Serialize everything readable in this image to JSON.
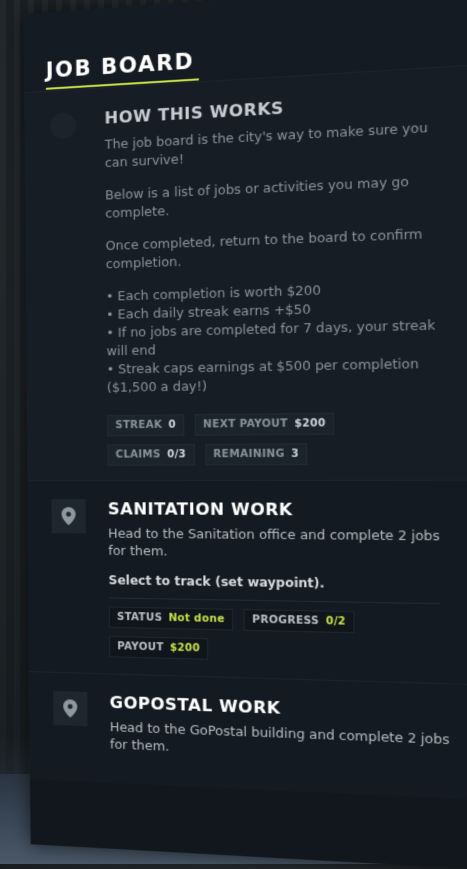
{
  "header": {
    "title": "JOB BOARD"
  },
  "info": {
    "title": "HOW THIS WORKS",
    "paragraphs": [
      "The job board is the city's way to make sure you can survive!",
      "Below is a list of jobs or activities you may go complete.",
      "Once completed, return to the board to confirm completion."
    ],
    "bullets": [
      "• Each completion is worth $200",
      "• Each daily streak earns +$50",
      "• If no jobs are completed for 7 days, your streak will end",
      "• Streak caps earnings at $500 per completion ($1,500 a day!)"
    ],
    "stats": {
      "streak_label": "STREAK",
      "streak_value": "0",
      "next_payout_label": "NEXT PAYOUT",
      "next_payout_value": "$200",
      "claims_label": "CLAIMS",
      "claims_value": "0/3",
      "remaining_label": "REMAINING",
      "remaining_value": "3"
    }
  },
  "jobs": [
    {
      "title": "SANITATION WORK",
      "description": "Head to the Sanitation office and complete 2 jobs for them.",
      "track_text": "Select to track (set waypoint).",
      "status_label": "STATUS",
      "status_value": "Not done",
      "progress_label": "PROGRESS",
      "progress_value": "0/2",
      "payout_label": "PAYOUT",
      "payout_value": "$200",
      "icon": "map-pin-icon"
    },
    {
      "title": "GOPOSTAL WORK",
      "description": "Head to the GoPostal building and complete 2 jobs for them.",
      "icon": "map-pin-icon"
    }
  ],
  "colors": {
    "accent": "#c8e04a",
    "panel_bg": "#11171d"
  }
}
